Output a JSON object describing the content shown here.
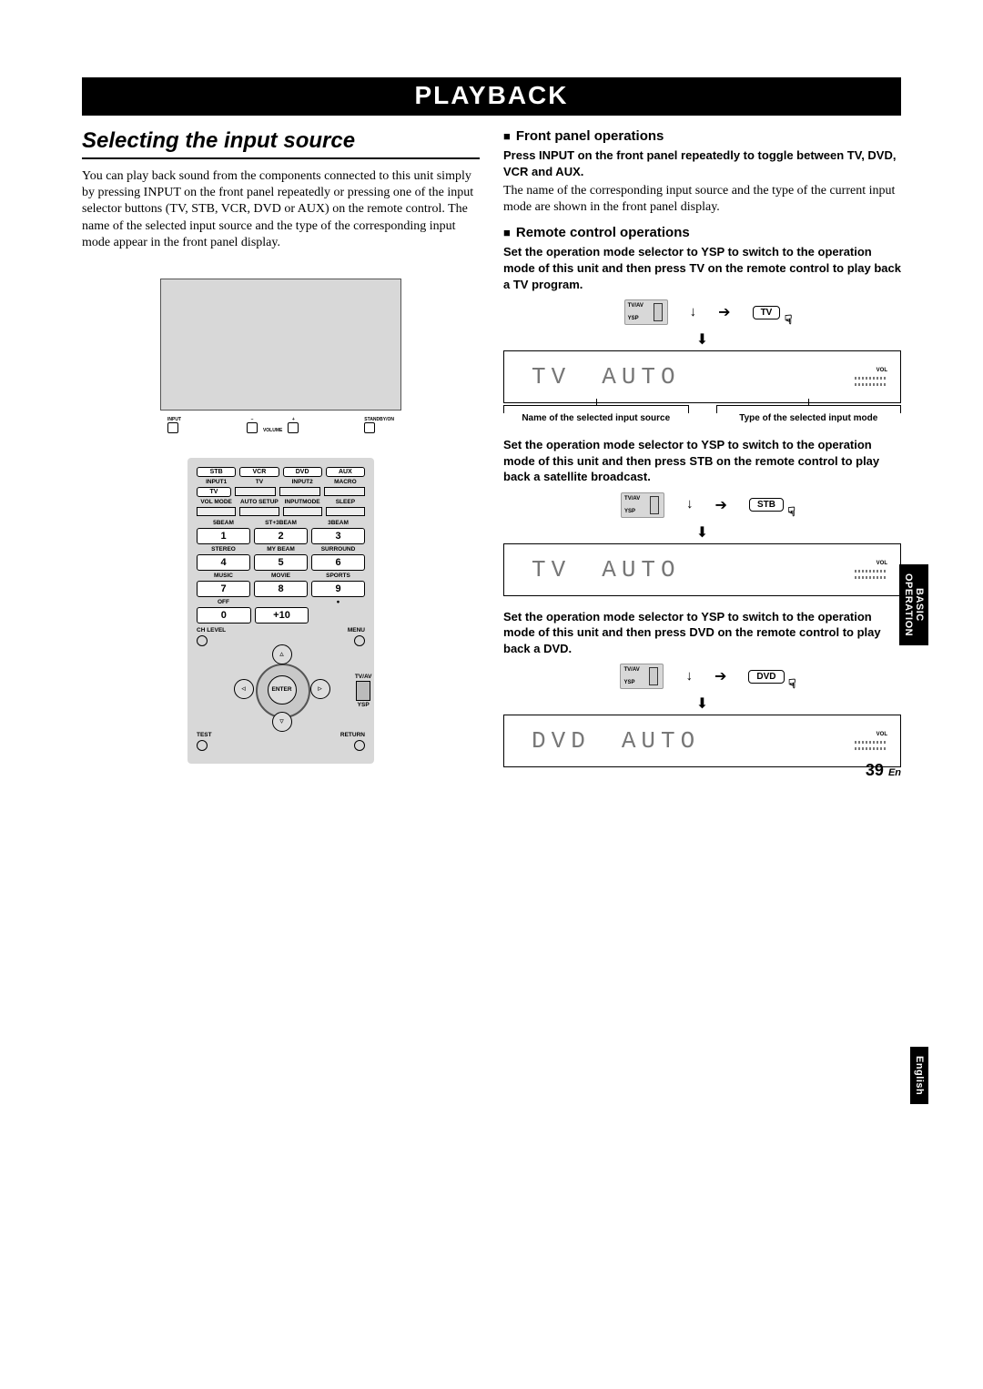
{
  "header": {
    "title": "PLAYBACK"
  },
  "section_title": "Selecting the input source",
  "left": {
    "intro": "You can play back sound from the components connected to this unit simply by pressing INPUT on the front panel repeatedly or pressing one of the input selector buttons (TV, STB, VCR, DVD or AUX) on the remote control. The name of the selected input source and the type of the corresponding input mode appear in the front panel display.",
    "front_panel_labels": {
      "input": "INPUT",
      "vol_minus": "VOLUME",
      "standby": "STANDBY/ON"
    },
    "remote": {
      "row1": [
        "STB",
        "VCR",
        "DVD",
        "AUX"
      ],
      "tv": "TV",
      "row2_labels": [
        "INPUT1",
        "TV",
        "INPUT2",
        "MACRO"
      ],
      "row3_labels": [
        "VOL MODE",
        "AUTO SETUP",
        "INPUTMODE",
        "SLEEP"
      ],
      "beam_row": [
        "5BEAM",
        "ST+3BEAM",
        "3BEAM"
      ],
      "num_row2_labels": [
        "STEREO",
        "MY BEAM",
        "SURROUND"
      ],
      "num_row3_labels": [
        "MUSIC",
        "MOVIE",
        "SPORTS"
      ],
      "num_row4_labels": [
        "OFF",
        "",
        "●"
      ],
      "nums": [
        "1",
        "2",
        "3",
        "4",
        "5",
        "6",
        "7",
        "8",
        "9",
        "0",
        "+10"
      ],
      "ch_level": "CH LEVEL",
      "menu": "MENU",
      "enter": "ENTER",
      "tv_av": "TV/AV",
      "ysp": "YSP",
      "test": "TEST",
      "return": "RETURN"
    }
  },
  "right": {
    "h1": "Front panel operations",
    "p1": "Press INPUT on the front panel repeatedly to toggle between TV, DVD, VCR and AUX.",
    "p1b": "The name of the corresponding input source and the type of the current input mode are shown in the front panel display.",
    "h2": "Remote control operations",
    "p2": "Set the operation mode selector to YSP to switch to the operation mode of this unit and then press TV on the remote control to play back a TV program.",
    "p3": "Set the operation mode selector to YSP to switch to the operation mode of this unit and then press STB on the remote control to play back a satellite broadcast.",
    "p4": "Set the operation mode selector to YSP to switch to the operation mode of this unit and then press DVD on the remote control to play back a DVD.",
    "switch": {
      "top": "TV/AV",
      "bottom": "YSP"
    },
    "buttons": {
      "tv": "TV",
      "stb": "STB",
      "dvd": "DVD"
    },
    "displays": {
      "d1": {
        "src": "TV",
        "mode": "AUTO",
        "vol": "VOL"
      },
      "d2": {
        "src": "TV",
        "mode": "AUTO",
        "vol": "VOL"
      },
      "d3": {
        "src": "DVD",
        "mode": "AUTO",
        "vol": "VOL"
      }
    },
    "captions": {
      "c1": "Name of the selected input source",
      "c2": "Type of the selected input mode"
    }
  },
  "side_tabs": {
    "t1_a": "BASIC",
    "t1_b": "OPERATION",
    "t2": "English"
  },
  "footer": {
    "page": "39",
    "lang": "En"
  }
}
